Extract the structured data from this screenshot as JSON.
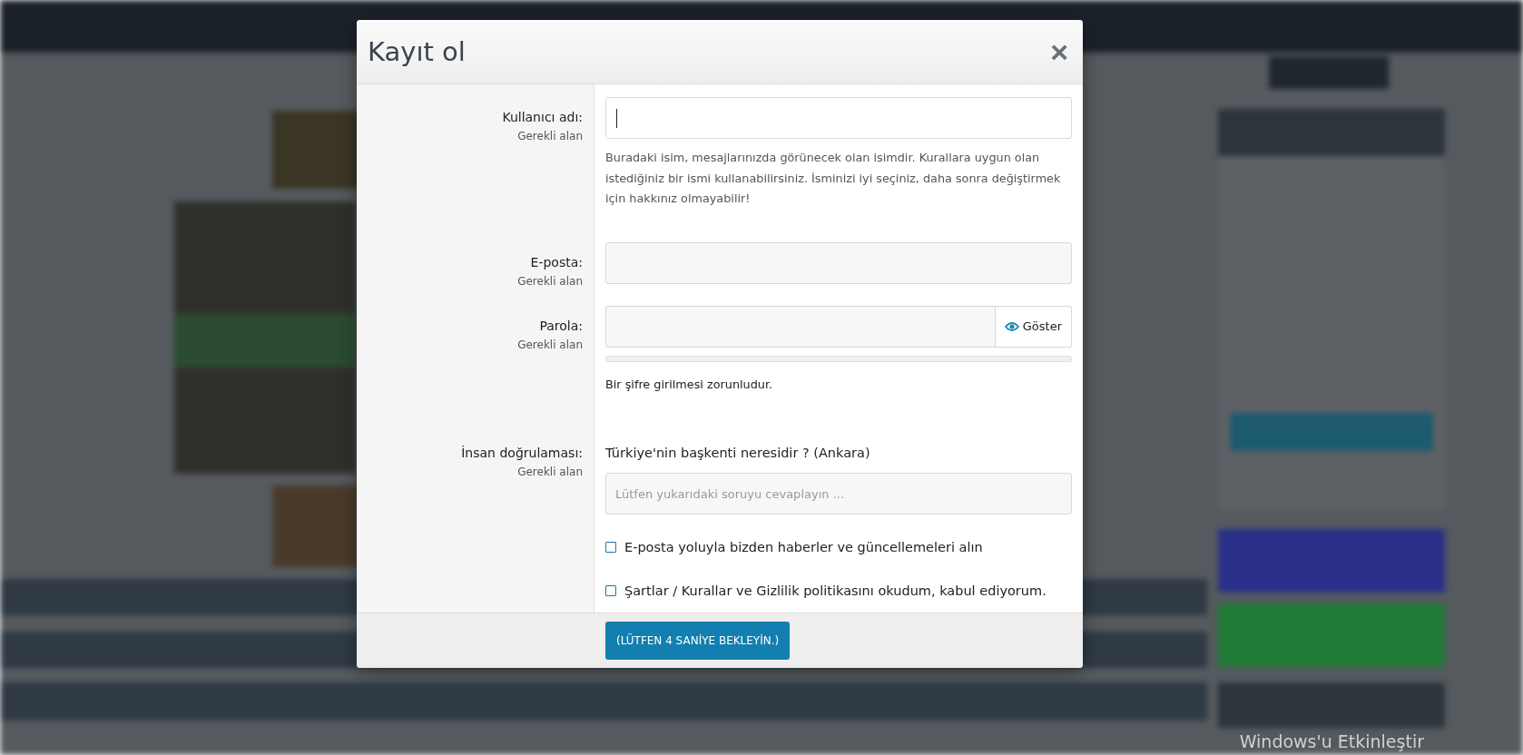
{
  "modal": {
    "title": "Kayıt ol",
    "close": "×",
    "fields": [
      {
        "kind": "text",
        "label": "Kullanıcı adı:",
        "note": "Gerekli alan",
        "focused": true,
        "help": "Buradaki isim, mesajlarınızda görünecek olan isimdir. Kurallara uygun olan istediğiniz bir ismi kullanabilirsiniz. İsminizi iyi seçiniz, daha sonra değiştirmek için hakkınız olmayabilir!"
      },
      {
        "kind": "text",
        "label": "E-posta:",
        "note": "Gerekli alan",
        "focused": false
      },
      {
        "kind": "password",
        "label": "Parola:",
        "note": "Gerekli alan",
        "focused": false,
        "show_button": "Göster",
        "level": 0,
        "help": "Bir şifre girilmesi zorunludur."
      },
      {
        "kind": "question",
        "label": "İnsan doğrulaması:",
        "note": "Gerekli alan",
        "focused": false,
        "question": "Türkiye'nin başkenti neresidir ? (Ankara)",
        "placeholder": "Lütfen yukarıdaki soruyu cevaplayın ..."
      }
    ],
    "checkboxes": [
      {
        "label": "E-posta yoluyla bizden haberler ve güncellemeleri alın",
        "checked": false
      },
      {
        "label": "Şartlar / Kurallar ve Gizlilik politikasını okudum, kabul ediyorum.",
        "checked": false
      }
    ],
    "submit": "(LÜTFEN 4 SANİYE BEKLEYİN.)"
  },
  "os_notice": "Windows'u Etkinleştir"
}
